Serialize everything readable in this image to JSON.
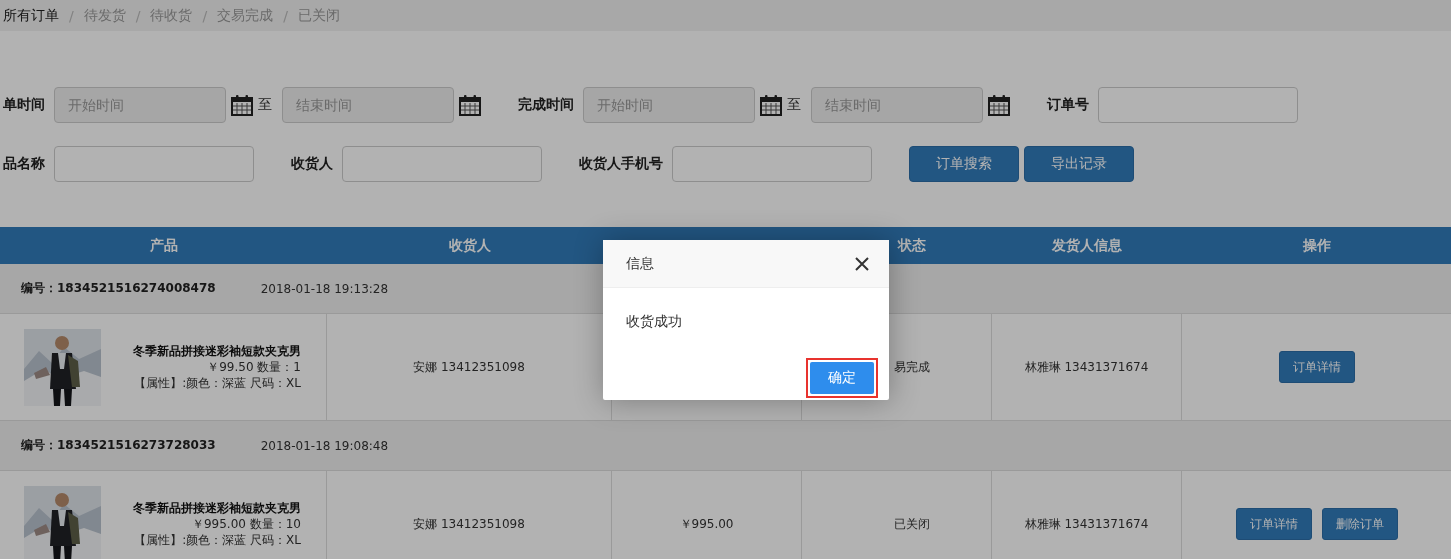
{
  "breadcrumb": [
    {
      "label": "所有订单",
      "selected": true
    },
    {
      "separator": "/",
      "label": "待发货",
      "selected": false
    },
    {
      "separator": "/",
      "label": "待收货",
      "selected": false
    },
    {
      "separator": "/",
      "label": "交易完成",
      "selected": false
    },
    {
      "separator": "/",
      "label": "已关闭",
      "selected": false
    }
  ],
  "filters": [
    [
      {
        "kind": "label",
        "text": "单时间"
      },
      {
        "kind": "date",
        "placeholder": "开始时间"
      },
      {
        "kind": "sep",
        "text": "至"
      },
      {
        "kind": "date",
        "placeholder": "结束时间"
      },
      {
        "kind": "label",
        "text": "完成时间"
      },
      {
        "kind": "date",
        "placeholder": "开始时间"
      },
      {
        "kind": "sep",
        "text": "至"
      },
      {
        "kind": "date",
        "placeholder": "结束时间"
      },
      {
        "kind": "label",
        "text": "订单号"
      },
      {
        "kind": "input"
      }
    ],
    [
      {
        "kind": "label",
        "text": "品名称"
      },
      {
        "kind": "input"
      },
      {
        "kind": "label",
        "text": "收货人"
      },
      {
        "kind": "input"
      },
      {
        "kind": "label",
        "text": "收货人手机号"
      },
      {
        "kind": "input"
      },
      {
        "kind": "button",
        "text": "订单搜索"
      },
      {
        "kind": "button",
        "text": "导出记录"
      }
    ]
  ],
  "table": {
    "columns": [
      "产品",
      "收货人",
      "",
      "状态",
      "发货人信息",
      "操作"
    ],
    "orders": [
      {
        "number": "编号：1834521516274008478",
        "time": "2018-01-18 19:13:28",
        "product": "冬季新品拼接迷彩袖短款夹克男",
        "price": "￥99.50 数量：1",
        "attributes": "【属性】:颜色：深蓝 尺码：XL",
        "receiver": "安娜 13412351098",
        "status": "易完成",
        "shipper": "林雅琳 13431371674",
        "actions": [
          "订单详情"
        ]
      },
      {
        "number": "编号：1834521516273728033",
        "time": "2018-01-18 19:08:48",
        "product": "冬季新品拼接迷彩袖短款夹克男",
        "price": "￥995.00 数量：10",
        "attributes": "【属性】:颜色：深蓝 尺码：XL",
        "receiver": "安娜 13412351098",
        "amount": "￥995.00",
        "status": "已关闭",
        "shipper": "林雅琳 13431371674",
        "actions": [
          "订单详情",
          "删除订单"
        ]
      }
    ]
  },
  "dialog": {
    "title": "信息",
    "message": "收货成功",
    "button": "确定"
  }
}
